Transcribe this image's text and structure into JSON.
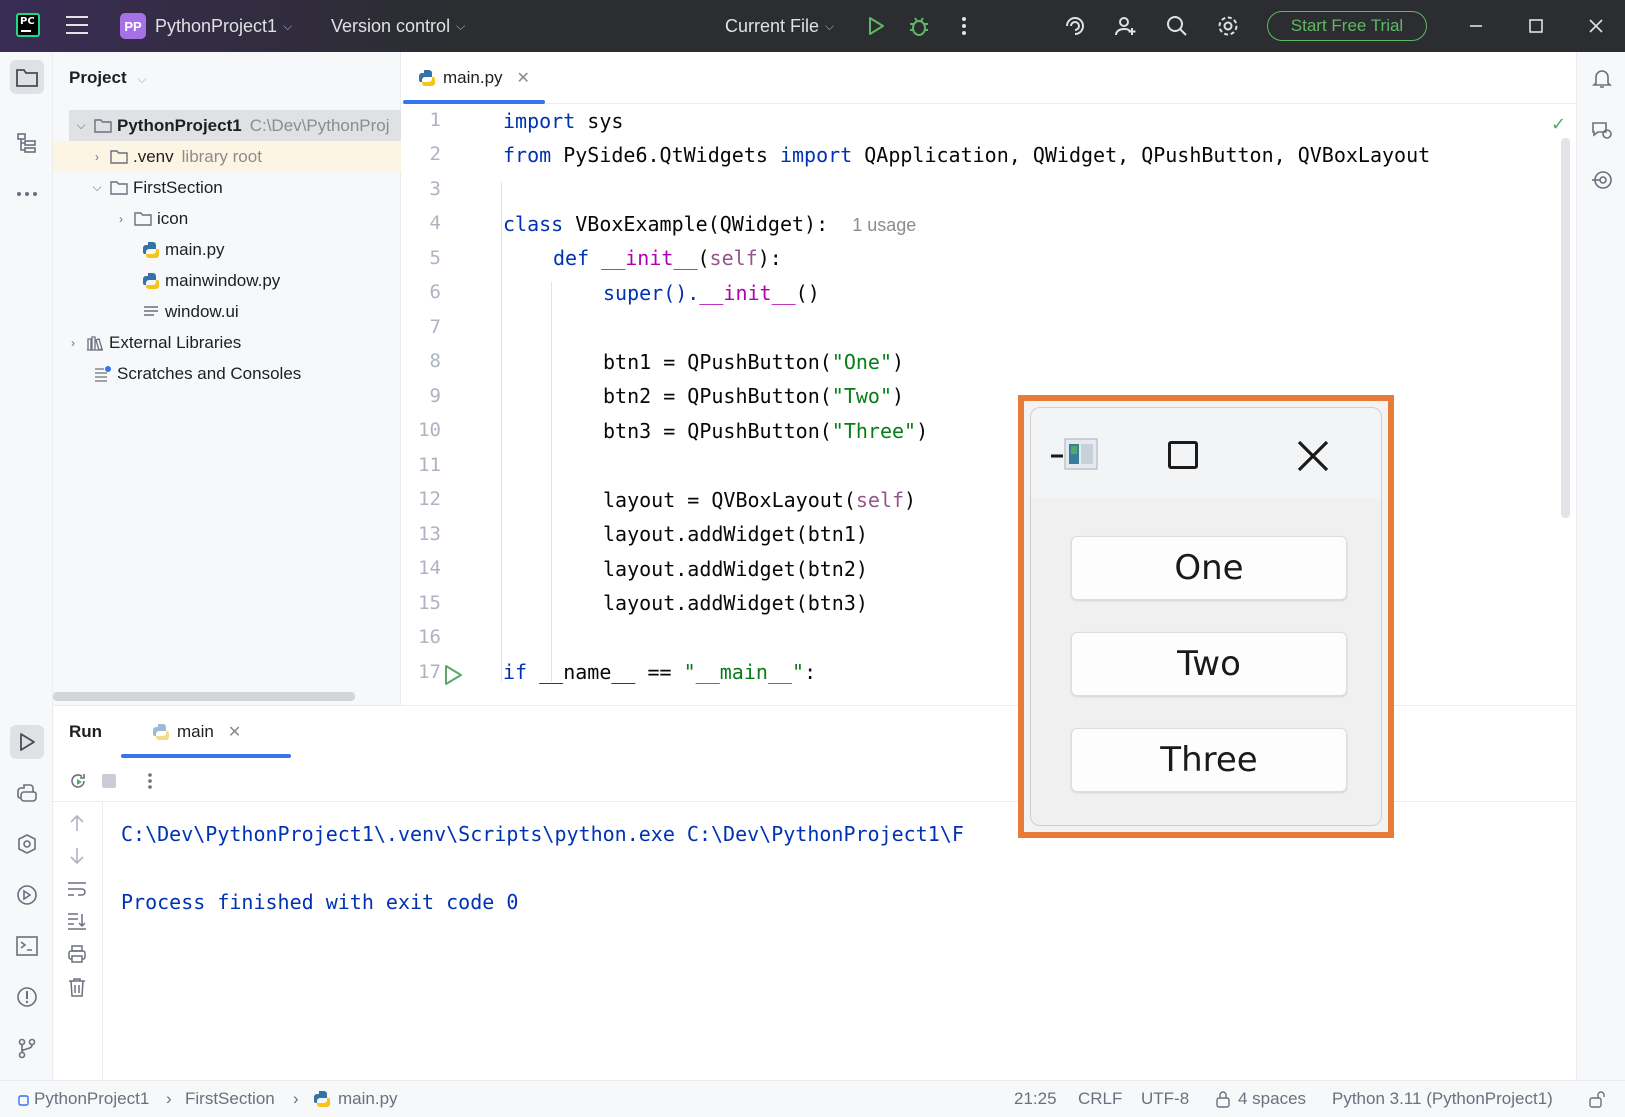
{
  "titlebar": {
    "project_badge": "PP",
    "project_name": "PythonProject1",
    "vcs": "Version control",
    "run_config": "Current File",
    "trial_button": "Start Free Trial"
  },
  "project_panel": {
    "title": "Project",
    "tree": [
      {
        "label": "PythonProject1",
        "extra": "C:\\Dev\\PythonProj"
      },
      {
        "label": ".venv",
        "extra": "library root"
      },
      {
        "label": "FirstSection",
        "extra": ""
      },
      {
        "label": "icon",
        "extra": ""
      },
      {
        "label": "main.py",
        "extra": ""
      },
      {
        "label": "mainwindow.py",
        "extra": ""
      },
      {
        "label": "window.ui",
        "extra": ""
      },
      {
        "label": "External Libraries",
        "extra": ""
      },
      {
        "label": "Scratches and Consoles",
        "extra": ""
      }
    ]
  },
  "editor": {
    "tab": "main.py",
    "line_numbers": [
      "1",
      "2",
      "3",
      "4",
      "5",
      "6",
      "7",
      "8",
      "9",
      "10",
      "11",
      "12",
      "13",
      "14",
      "15",
      "16",
      "17"
    ],
    "code": {
      "l1_kw": "import",
      "l1_rest": " sys",
      "l2_kw1": "from",
      "l2_mod": " PySide6.QtWidgets ",
      "l2_kw2": "import",
      "l2_rest": " QApplication, QWidget, QPushButton, QVBoxLayout",
      "l4_kw": "class",
      "l4_rest": " VBoxExample(QWidget):",
      "l4_hint": "1 usage",
      "l5_kw": "def",
      "l5_fn": "__init__",
      "l5_p1": "(",
      "l5_self": "self",
      "l5_p2": "):",
      "l6_a": "super().",
      "l6_fn": "__init__",
      "l6_b": "()",
      "l8_a": "btn1 = QPushButton(",
      "l8_s": "\"One\"",
      "l8_b": ")",
      "l9_a": "btn2 = QPushButton(",
      "l9_s": "\"Two\"",
      "l9_b": ")",
      "l10_a": "btn3 = QPushButton(",
      "l10_s": "\"Three\"",
      "l10_b": ")",
      "l12_a": "layout = QVBoxLayout(",
      "l12_self": "self",
      "l12_b": ")",
      "l13": "layout.addWidget(btn1)",
      "l14": "layout.addWidget(btn2)",
      "l15": "layout.addWidget(btn3)",
      "l17_kw": "if",
      "l17_a": " __name__ == ",
      "l17_s": "\"__main__\"",
      "l17_b": ":"
    }
  },
  "run_panel": {
    "title": "Run",
    "tab": "main",
    "console": [
      "C:\\Dev\\PythonProject1\\.venv\\Scripts\\python.exe C:\\Dev\\PythonProject1\\F",
      "Process finished with exit code 0"
    ]
  },
  "statusbar": {
    "breadcrumb": [
      "PythonProject1",
      "FirstSection",
      "main.py"
    ],
    "position": "21:25",
    "line_sep": "CRLF",
    "encoding": "UTF-8",
    "indent": "4 spaces",
    "interpreter": "Python 3.11 (PythonProject1)"
  },
  "qt_window": {
    "buttons": [
      "One",
      "Two",
      "Three"
    ],
    "highlight_color": "#e87b37"
  },
  "colors": {
    "keyword": "#0033b3",
    "string": "#067d17",
    "self": "#94558d",
    "dunder": "#b200b2",
    "accent": "#3574f0",
    "trial_green": "#5fb865"
  }
}
